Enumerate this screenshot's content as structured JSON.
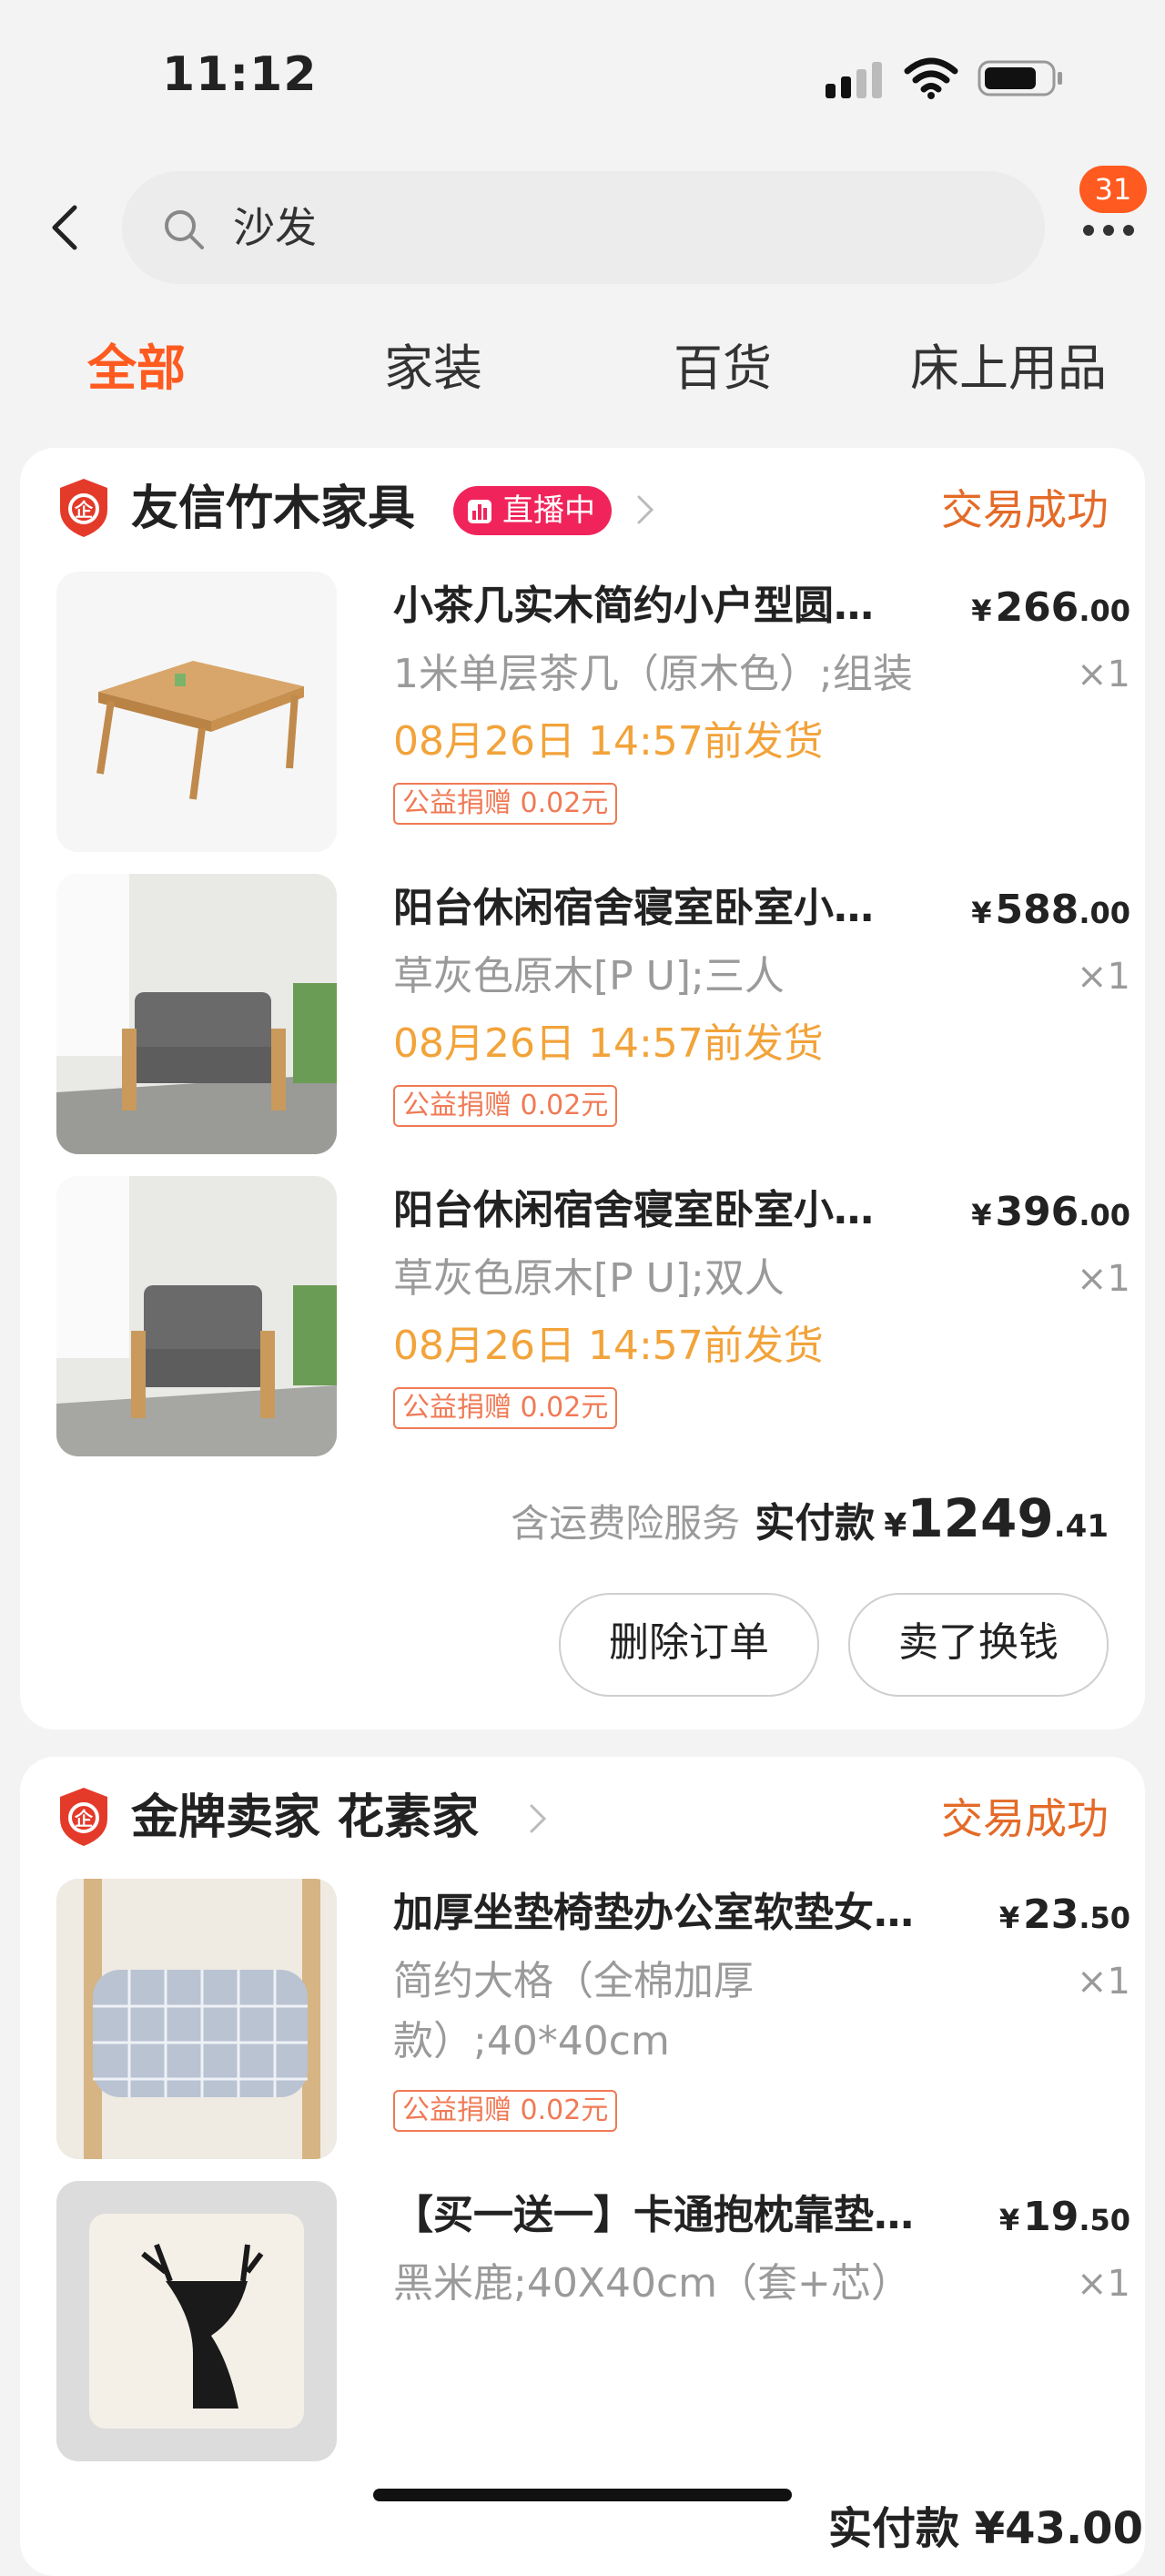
{
  "status_bar": {
    "time": "11:12"
  },
  "header": {
    "search_text": "沙发",
    "badge_count": "31"
  },
  "tabs": [
    "全部",
    "家装",
    "百货",
    "床上用品"
  ],
  "orders": [
    {
      "shop_name": "友信竹木家具",
      "live_label": "直播中",
      "status": "交易成功",
      "items": [
        {
          "title": "小茶几实木简约小户型圆…",
          "price_yen": "¥",
          "price_int": "266",
          "price_dec": ".00",
          "spec": "1米单层茶几（原木色）;组装",
          "qty": "×1",
          "ship": "08月26日 14:57前发货",
          "donate": "公益捐赠 0.02元"
        },
        {
          "title": "阳台休闲宿舍寝室卧室小…",
          "price_yen": "¥",
          "price_int": "588",
          "price_dec": ".00",
          "spec": "草灰色原木[P U];三人",
          "qty": "×1",
          "ship": "08月26日 14:57前发货",
          "donate": "公益捐赠 0.02元"
        },
        {
          "title": "阳台休闲宿舍寝室卧室小…",
          "price_yen": "¥",
          "price_int": "396",
          "price_dec": ".00",
          "spec": "草灰色原木[P U];双人",
          "qty": "×1",
          "ship": "08月26日 14:57前发货",
          "donate": "公益捐赠 0.02元"
        }
      ],
      "service_text": "含运费险服务",
      "paid_label": "实付款",
      "paid_yen": "¥",
      "paid_int": "1249",
      "paid_dec": ".41",
      "buttons": [
        "删除订单",
        "卖了换钱"
      ]
    },
    {
      "shop_name": "金牌卖家 花素家",
      "status": "交易成功",
      "items": [
        {
          "title": "加厚坐垫椅垫办公室软垫女…",
          "price_yen": "¥",
          "price_int": "23",
          "price_dec": ".50",
          "spec": "简约大格（全棉加厚款）;40*40cm",
          "qty": "×1",
          "donate": "公益捐赠 0.02元"
        },
        {
          "title": "【买一送一】卡通抱枕靠垫…",
          "price_yen": "¥",
          "price_int": "19",
          "price_dec": ".50",
          "spec": "黑米鹿;40X40cm（套+芯）",
          "qty": "×1"
        }
      ],
      "paid_label": "实付款",
      "paid_yen": "¥",
      "paid_int": "43",
      "paid_dec": ".00"
    }
  ],
  "colors": {
    "accent": "#ff5a1f",
    "status": "#e46a28",
    "ship": "#f2a33a",
    "live": "#f0245a"
  },
  "icons": [
    "back-icon",
    "search-icon",
    "more-icon",
    "shield-logo-icon",
    "chevron-right-icon",
    "live-bars-icon",
    "signal-icon",
    "wifi-icon",
    "battery-icon"
  ]
}
